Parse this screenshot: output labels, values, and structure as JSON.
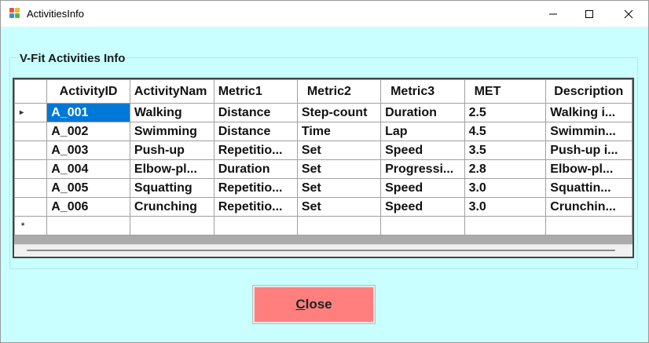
{
  "window": {
    "title": "ActivitiesInfo",
    "controls": {
      "minimize_icon": "minimize-icon",
      "maximize_icon": "maximize-icon",
      "close_icon": "close-icon"
    }
  },
  "group": {
    "label": "V-Fit Activities Info"
  },
  "grid": {
    "columns": [
      "ActivityID",
      "ActivityNam",
      "Metric1",
      "Metric2",
      "Metric3",
      "MET",
      "Description"
    ],
    "rows": [
      [
        "A_001",
        "Walking",
        "Distance",
        "Step-count",
        "Duration",
        "2.5",
        "Walking i..."
      ],
      [
        "A_002",
        "Swimming",
        "Distance",
        "Time",
        "Lap",
        "4.5",
        "Swimmin..."
      ],
      [
        "A_003",
        "Push-up",
        "Repetitio...",
        "Set",
        "Speed",
        "3.5",
        "Push-up i..."
      ],
      [
        "A_004",
        "Elbow-pl...",
        "Duration",
        "Set",
        "Progressi...",
        "2.8",
        "Elbow-pl..."
      ],
      [
        "A_005",
        "Squatting",
        "Repetitio...",
        "Set",
        "Speed",
        "3.0",
        "Squattin..."
      ],
      [
        "A_006",
        "Crunching",
        "Repetitio...",
        "Set",
        "Speed",
        "3.0",
        "Crunchin..."
      ]
    ],
    "current_row_marker": "▸",
    "new_row_marker": "*"
  },
  "buttons": {
    "close_label_underlined": "C",
    "close_label_rest": "lose"
  },
  "colors": {
    "background": "#c9ffff",
    "close_button": "#ff7f7f",
    "selection": "#0078d7"
  }
}
